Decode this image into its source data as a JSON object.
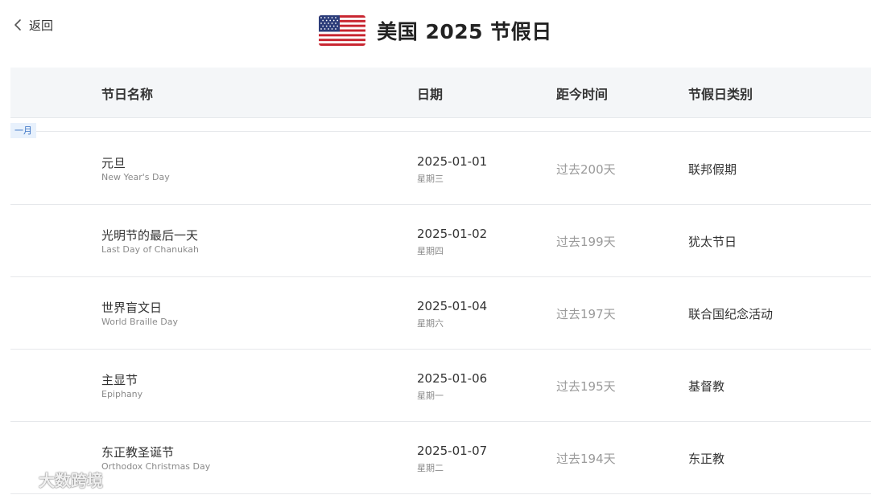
{
  "nav": {
    "back_label": "返回"
  },
  "header": {
    "title": "美国 2025 节假日",
    "flag_icon": "us-flag-icon"
  },
  "table": {
    "columns": [
      "节日名称",
      "日期",
      "距今时间",
      "节假日类别"
    ],
    "month_label": "一月",
    "rows": [
      {
        "name_zh": "元旦",
        "name_en": "New Year's Day",
        "date": "2025-01-01",
        "weekday": "星期三",
        "elapsed": "过去200天",
        "category": "联邦假期"
      },
      {
        "name_zh": "光明节的最后一天",
        "name_en": "Last Day of Chanukah",
        "date": "2025-01-02",
        "weekday": "星期四",
        "elapsed": "过去199天",
        "category": "犹太节日"
      },
      {
        "name_zh": "世界盲文日",
        "name_en": "World Braille Day",
        "date": "2025-01-04",
        "weekday": "星期六",
        "elapsed": "过去197天",
        "category": "联合国纪念活动"
      },
      {
        "name_zh": "主显节",
        "name_en": "Epiphany",
        "date": "2025-01-06",
        "weekday": "星期一",
        "elapsed": "过去195天",
        "category": "基督教"
      },
      {
        "name_zh": "东正教圣诞节",
        "name_en": "Orthodox Christmas Day",
        "date": "2025-01-07",
        "weekday": "星期二",
        "elapsed": "过去194天",
        "category": "东正教"
      }
    ]
  },
  "watermark": {
    "text": "大数跨境",
    "icon": "brand-logo-icon"
  },
  "colors": {
    "header_bg": "#f4f6f8",
    "month_tag_bg": "#e8f1fc",
    "month_tag_text": "#3a73c4",
    "muted_text": "#9a9a9a"
  }
}
